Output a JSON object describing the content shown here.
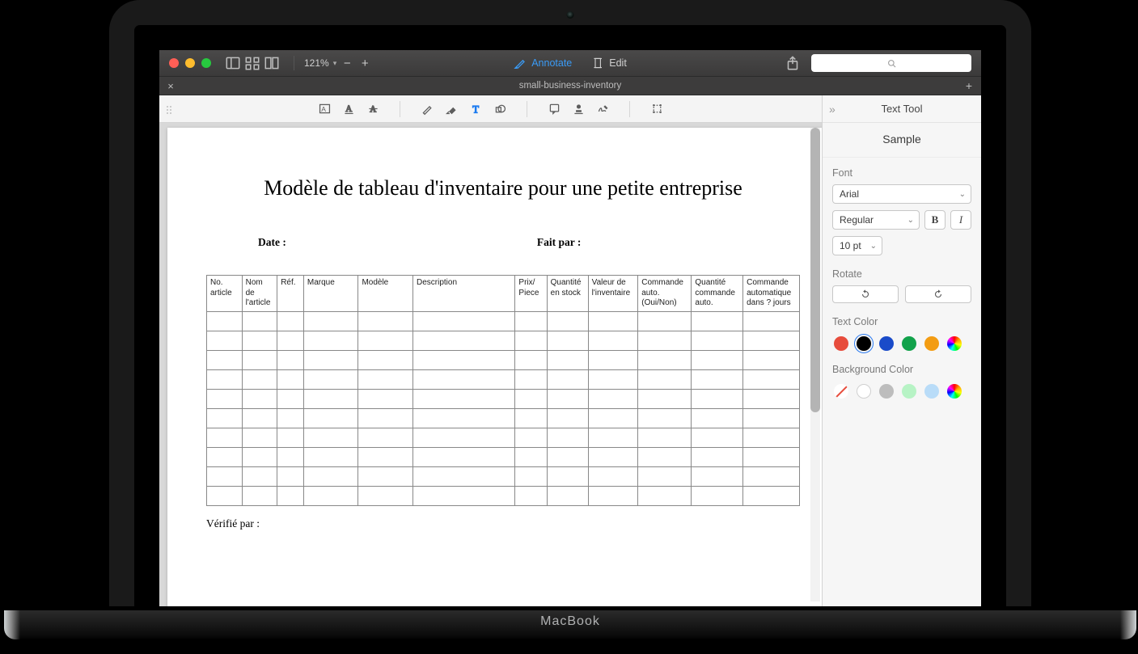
{
  "toolbar": {
    "zoom": "121%",
    "annotate_label": "Annotate",
    "edit_label": "Edit"
  },
  "tab": {
    "title": "small-business-inventory"
  },
  "sidebar": {
    "title": "Text Tool",
    "sample": "Sample",
    "font_label": "Font",
    "font_family": "Arial",
    "font_weight": "Regular",
    "bold_label": "B",
    "italic_label": "I",
    "font_size": "10 pt",
    "rotate_label": "Rotate",
    "text_color_label": "Text Color",
    "bg_color_label": "Background Color",
    "text_colors": [
      "#e74c3c",
      "#000000",
      "#1a4bc9",
      "#12a24b",
      "#f39c12"
    ],
    "text_color_selected_index": 1,
    "bg_colors_solid": [
      "#ffffff",
      "#bdbdbd",
      "#b7f3c5",
      "#b9dcf8"
    ],
    "bg_none_selected": true
  },
  "document": {
    "title": "Modèle de tableau d'inventaire pour une petite entreprise",
    "date_label": "Date :",
    "fait_par_label": "Fait par :",
    "verifie_label": "Vérifié par :",
    "columns": [
      "No. article",
      "Nom de l'article",
      "Réf.",
      "Marque",
      "Modèle",
      "Description",
      "Prix/ Piece",
      "Quantité en stock",
      "Valeur de l'inventaire",
      "Commande auto. (Oui/Non)",
      "Quantité commande auto.",
      "Commande automatique dans ? jours"
    ],
    "empty_rows": 10
  },
  "macbook_brand": "MacBook"
}
